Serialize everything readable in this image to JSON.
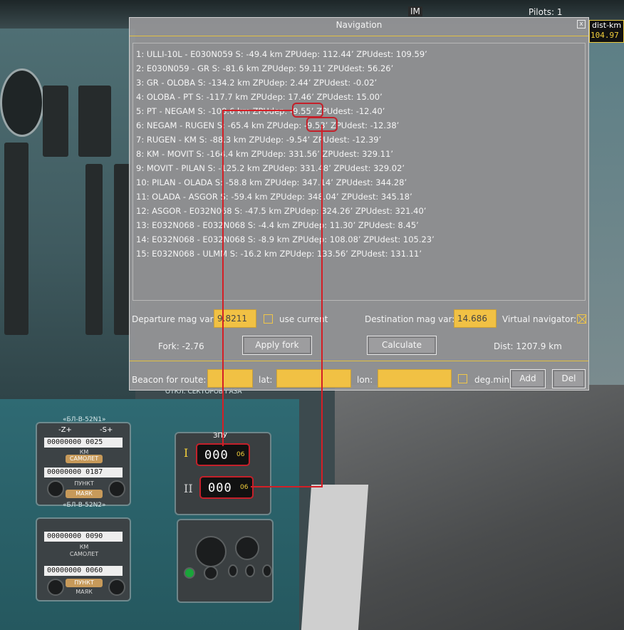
{
  "hud": {
    "im_label": "IM",
    "pilots_label": "Pilots:",
    "pilots_count": "1",
    "dist_label": "dist-km",
    "dist_value": "104.97"
  },
  "nav": {
    "title": "Navigation",
    "close_label": "x",
    "routes": [
      "1: ULLI-10L - E030N059 S: -49.4 km ZPUdep: 112.44’ ZPUdest: 109.59’",
      "2: E030N059 - GR S: -81.6 km ZPUdep: 59.11’ ZPUdest: 56.26’",
      "3: GR - OLOBA S: -134.2 km ZPUdep: 2.44’ ZPUdest: -0.02’",
      "4: OLOBA - PT S: -117.7 km ZPUdep: 17.46’ ZPUdest: 15.00’",
      "5: PT - NEGAM S: -108.6 km ZPUdep: -9.55’ ZPUdest: -12.40’",
      "6: NEGAM - RUGEN S: -65.4 km ZPUdep: -9.53’ ZPUdest: -12.38’",
      "7: RUGEN - KM S: -88.3 km ZPUdep: -9.54’ ZPUdest: -12.39’",
      "8: KM - MOVIT S: -164.4 km ZPUdep: 331.56’ ZPUdest: 329.11’",
      "9: MOVIT - PILAN S: -125.2 km ZPUdep: 331.48’ ZPUdest: 329.02’",
      "10: PILAN - OLADA S: -58.8 km ZPUdep: 347.14’ ZPUdest: 344.28’",
      "11: OLADA - ASGOR S: -59.4 km ZPUdep: 348.04’ ZPUdest: 345.18’",
      "12: ASGOR - E032N068 S: -47.5 km ZPUdep: 324.26’ ZPUdest: 321.40’",
      "13: E032N068 - E032N068 S: -4.4 km ZPUdep: 11.30’ ZPUdest: 8.45’",
      "14: E032N068 - E032N068 S: -8.9 km ZPUdep: 108.08’ ZPUdest: 105.23’",
      "15: E032N068 - ULMM S: -16.2 km ZPUdep: 133.56’ ZPUdest: 131.11’"
    ],
    "departure_label": "Departure mag var:",
    "departure_value": "9.8211",
    "use_current_label": "use current",
    "destination_label": "Destination mag var:",
    "destination_value": "14.686",
    "virtual_nav_label": "Virtual navigator:",
    "fork_label": "Fork: -2.76",
    "apply_fork_label": "Apply fork",
    "calculate_label": "Calculate",
    "dist_label": "Dist: 1207.9 km",
    "beacon_label": "Beacon for route:",
    "beacon_value": "",
    "lat_label": "lat:",
    "lat_value": "",
    "lon_label": "lon:",
    "lon_value": "",
    "degmin_label": "deg.min",
    "add_label": "Add",
    "del_label": "Del"
  },
  "panel": {
    "top_block_label": "«БЛ-В-52N1»",
    "bottom_block_label": "«БЛ-В-52N2»",
    "z_label": "-Z+",
    "s_label": "-S+",
    "n1_row1": "00000000 0025",
    "n1_row2": "00000000 0187",
    "n2_row1": "00000000 0090",
    "n2_row2": "00000000 0060",
    "km_label": "КМ",
    "samolet_label": "САМОЛЕТ",
    "punkt_label": "ПУНКТ",
    "mayak_label": "МАЯК",
    "zpu_label": "ЗПУ",
    "zpu_counter1": "000",
    "zpu_counter2": "000",
    "zpu_mins": "06",
    "roman1": "I",
    "roman2": "II",
    "sector_label": "ОТКЛ. СЕКТОРОВ ГАЗА"
  }
}
